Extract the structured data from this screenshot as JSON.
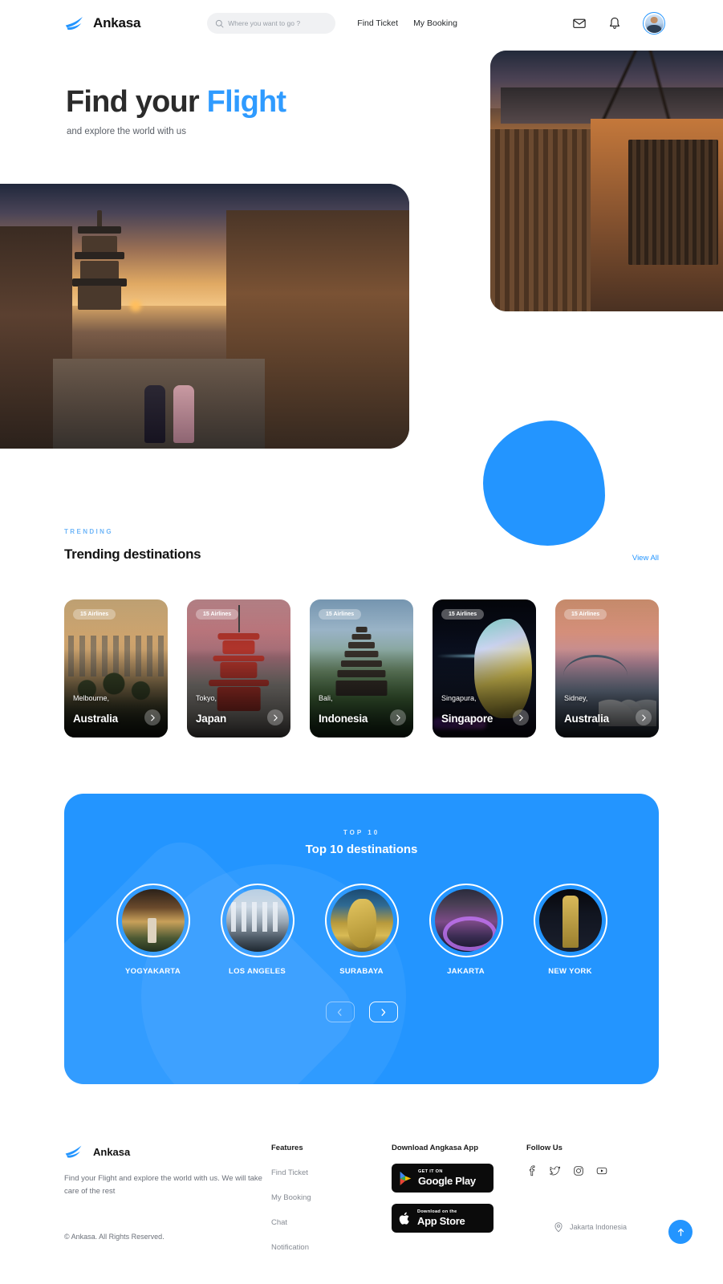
{
  "brand": {
    "name": "Ankasa",
    "logo_icon": "bird-logo-icon"
  },
  "header": {
    "search": {
      "placeholder": "Where you want to go ?",
      "value": "",
      "icon": "search-icon"
    },
    "nav": [
      {
        "label": "Find Ticket"
      },
      {
        "label": "My Booking"
      }
    ],
    "icons": [
      {
        "name": "mail-icon"
      },
      {
        "name": "bell-icon"
      },
      {
        "name": "avatar"
      }
    ]
  },
  "hero": {
    "title_plain": "Find your ",
    "title_accent": "Flight",
    "subtitle": "and explore the world with us",
    "accent_color": "#2f9bff"
  },
  "trending": {
    "eyebrow": "TRENDING",
    "title": "Trending destinations",
    "view_all": "View All",
    "cards": [
      {
        "badge": "15 Airlines",
        "city": "Melbourne,",
        "country": "Australia",
        "arrow_icon": "arrow-right-icon"
      },
      {
        "badge": "15 Airlines",
        "city": "Tokyo,",
        "country": "Japan",
        "arrow_icon": "arrow-right-icon"
      },
      {
        "badge": "15 Airlines",
        "city": "Bali,",
        "country": "Indonesia",
        "arrow_icon": "arrow-right-icon"
      },
      {
        "badge": "15 Airlines",
        "city": "Singapura,",
        "country": "Singapore",
        "arrow_icon": "arrow-right-icon"
      },
      {
        "badge": "15 Airlines",
        "city": "Sidney,",
        "country": "Australia",
        "arrow_icon": "arrow-right-icon"
      }
    ]
  },
  "top10": {
    "eyebrow": "TOP 10",
    "title": "Top 10 destinations",
    "panel_color": "#2395ff",
    "items": [
      {
        "label": "YOGYAKARTA"
      },
      {
        "label": "LOS ANGELES"
      },
      {
        "label": "SURABAYA"
      },
      {
        "label": "JAKARTA"
      },
      {
        "label": "NEW YORK"
      }
    ],
    "prev_icon": "chevron-left-icon",
    "next_icon": "chevron-right-icon"
  },
  "footer": {
    "brand_name": "Ankasa",
    "description": "Find your Flight and explore the world with us. We will take care of the rest",
    "copyright": "© Ankasa. All Rights Reserved.",
    "features": {
      "title": "Features",
      "links": [
        {
          "label": "Find Ticket"
        },
        {
          "label": "My Booking"
        },
        {
          "label": "Chat"
        },
        {
          "label": "Notification"
        }
      ]
    },
    "download": {
      "title": "Download Angkasa App",
      "google": {
        "small": "GET IT ON",
        "big": "Google Play",
        "icon": "google-play-icon"
      },
      "apple": {
        "small": "Download on the",
        "big": "App Store",
        "icon": "apple-icon"
      }
    },
    "social": {
      "title": "Follow Us",
      "icons": [
        {
          "name": "facebook-icon"
        },
        {
          "name": "twitter-icon"
        },
        {
          "name": "instagram-icon"
        },
        {
          "name": "youtube-icon"
        }
      ]
    },
    "location": {
      "text": "Jakarta Indonesia",
      "icon": "map-pin-icon"
    },
    "to_top_icon": "arrow-up-icon"
  }
}
